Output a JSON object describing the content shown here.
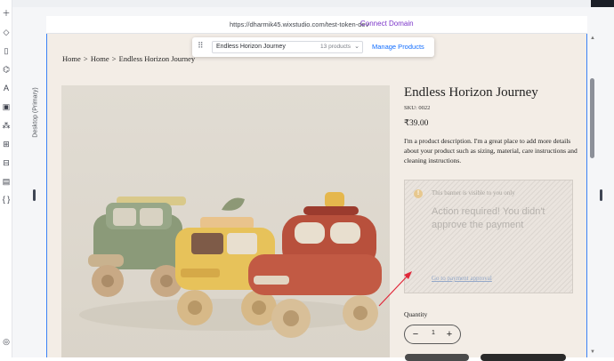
{
  "rail": {
    "icons": [
      "add-icon",
      "layers-icon",
      "pages-icon",
      "design-icon",
      "text-icon",
      "media-icon",
      "apps-icon",
      "app-market-icon",
      "business-icon",
      "cms-icon",
      "code-icon",
      "checklist-icon"
    ]
  },
  "editor": {
    "breakpoint_label": "Desktop (Primary)",
    "url": "https://dharmik45.wixstudio.com/test-token-dev",
    "connect_domain": "Connect Domain"
  },
  "toolbar": {
    "product_name": "Endless Horizon Journey",
    "product_count": "13 products",
    "manage_products": "Manage Products"
  },
  "breadcrumb": [
    "Home",
    ">",
    "Home",
    ">",
    "Endless Horizon Journey"
  ],
  "product": {
    "title": "Endless Horizon Journey",
    "sku": "SKU: 0022",
    "price": "₹39.00",
    "description": "I'm a product description. I'm a great place to add more details about your product such as sizing, material, care instructions and cleaning instructions."
  },
  "banner": {
    "icon_glyph": "!",
    "note": "This banner is visible to you only",
    "heading": "Action required! You didn't approve the payment",
    "link": "Go to payment approval"
  },
  "quantity": {
    "label": "Quantity",
    "value": "1",
    "minus": "−",
    "plus": "+"
  },
  "colors": {
    "page_background": "#f3ede6",
    "accent_blue": "#116dff",
    "connect_domain_purple": "#7b35c9",
    "annotation_red": "#e0283a"
  }
}
